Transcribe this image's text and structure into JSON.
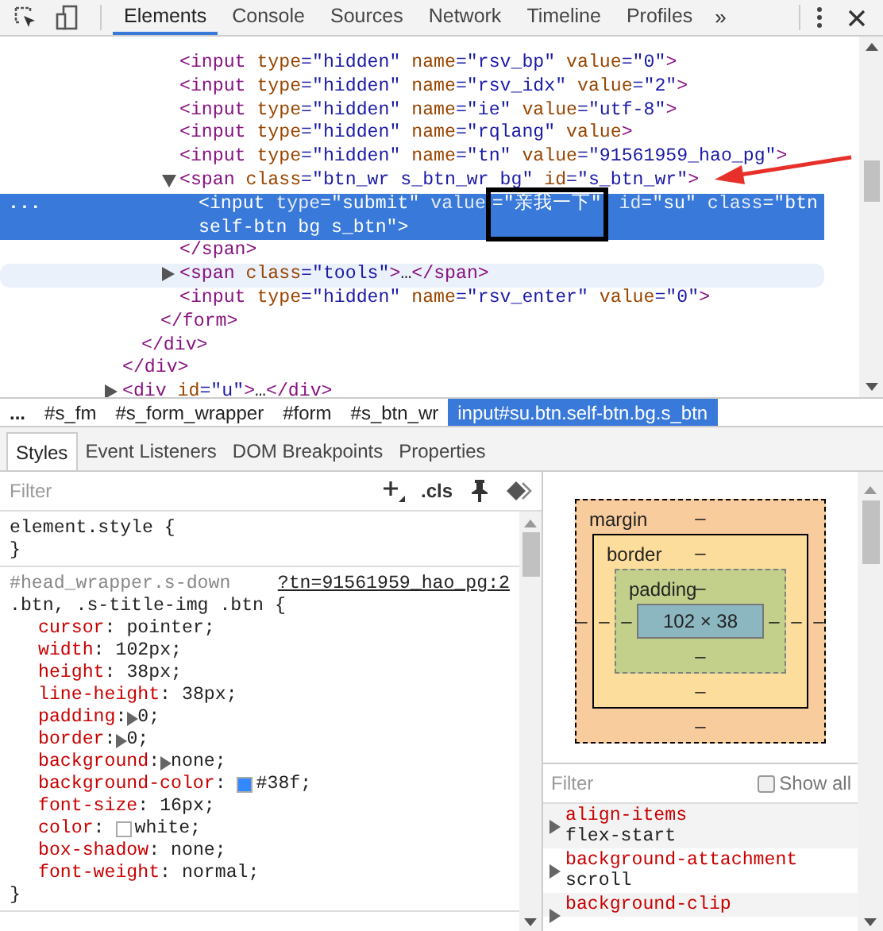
{
  "toolbar": {
    "tabs": [
      {
        "label": "Elements",
        "selected": true
      },
      {
        "label": "Console",
        "selected": false
      },
      {
        "label": "Sources",
        "selected": false
      },
      {
        "label": "Network",
        "selected": false
      },
      {
        "label": "Timeline",
        "selected": false
      },
      {
        "label": "Profiles",
        "selected": false
      }
    ],
    "more": "»"
  },
  "dom_tree": [
    {
      "close": [
        {
          "kind": "tag",
          "text": "</div>"
        }
      ],
      "children": [
        {
          "close": [
            {
              "kind": "tag",
              "text": "</div>"
            }
          ],
          "children": [
            {
              "close": [
                {
                  "kind": "tag",
                  "text": "</form>"
                }
              ],
              "children": [
                {
                  "parts": [
                    {
                      "kind": "tag",
                      "text": "<input"
                    },
                    {
                      "kind": "attr",
                      "text": " type"
                    },
                    {
                      "kind": "value",
                      "text": "=\"hidden\""
                    },
                    {
                      "kind": "attr",
                      "text": " name"
                    },
                    {
                      "kind": "value",
                      "text": "=\"rsv_bp\""
                    },
                    {
                      "kind": "attr",
                      "text": " value"
                    },
                    {
                      "kind": "value",
                      "text": "=\"0\""
                    },
                    {
                      "kind": "tag",
                      "text": ">"
                    }
                  ]
                },
                {
                  "parts": [
                    {
                      "kind": "tag",
                      "text": "<input"
                    },
                    {
                      "kind": "attr",
                      "text": " type"
                    },
                    {
                      "kind": "value",
                      "text": "=\"hidden\""
                    },
                    {
                      "kind": "attr",
                      "text": " name"
                    },
                    {
                      "kind": "value",
                      "text": "=\"rsv_idx\""
                    },
                    {
                      "kind": "attr",
                      "text": " value"
                    },
                    {
                      "kind": "value",
                      "text": "=\"2\""
                    },
                    {
                      "kind": "tag",
                      "text": ">"
                    }
                  ]
                },
                {
                  "parts": [
                    {
                      "kind": "tag",
                      "text": "<input"
                    },
                    {
                      "kind": "attr",
                      "text": " type"
                    },
                    {
                      "kind": "value",
                      "text": "=\"hidden\""
                    },
                    {
                      "kind": "attr",
                      "text": " name"
                    },
                    {
                      "kind": "value",
                      "text": "=\"ie\""
                    },
                    {
                      "kind": "attr",
                      "text": " value"
                    },
                    {
                      "kind": "value",
                      "text": "=\"utf-8\""
                    },
                    {
                      "kind": "tag",
                      "text": ">"
                    }
                  ]
                },
                {
                  "parts": [
                    {
                      "kind": "tag",
                      "text": "<input"
                    },
                    {
                      "kind": "attr",
                      "text": " type"
                    },
                    {
                      "kind": "value",
                      "text": "=\"hidden\""
                    },
                    {
                      "kind": "attr",
                      "text": " name"
                    },
                    {
                      "kind": "value",
                      "text": "=\"rqlang\""
                    },
                    {
                      "kind": "attr",
                      "text": " value"
                    },
                    {
                      "kind": "tag",
                      "text": ">"
                    }
                  ]
                },
                {
                  "parts": [
                    {
                      "kind": "tag",
                      "text": "<input"
                    },
                    {
                      "kind": "attr",
                      "text": " type"
                    },
                    {
                      "kind": "value",
                      "text": "=\"hidden\""
                    },
                    {
                      "kind": "attr",
                      "text": " name"
                    },
                    {
                      "kind": "value",
                      "text": "=\"tn\""
                    },
                    {
                      "kind": "attr",
                      "text": " value"
                    },
                    {
                      "kind": "value",
                      "text": "=\"91561959_hao_pg\""
                    },
                    {
                      "kind": "tag",
                      "text": ">"
                    }
                  ]
                },
                {
                  "parts": [
                    {
                      "kind": "tag",
                      "text": "<span"
                    },
                    {
                      "kind": "attr",
                      "text": " class"
                    },
                    {
                      "kind": "value",
                      "text": "=\"btn_wr s_btn_wr bg\""
                    },
                    {
                      "kind": "attr",
                      "text": " id"
                    },
                    {
                      "kind": "value",
                      "text": "=\"s_btn_wr\""
                    },
                    {
                      "kind": "tag",
                      "text": ">"
                    }
                  ],
                  "expanded": true,
                  "close": [
                    {
                      "kind": "tag",
                      "text": "</span>"
                    }
                  ],
                  "children": [
                    {
                      "parts": [
                        {
                          "kind": "tag",
                          "text": "<input"
                        },
                        {
                          "kind": "attr",
                          "text": " type"
                        },
                        {
                          "kind": "value",
                          "text": "=\"submit\""
                        },
                        {
                          "kind": "attr",
                          "text": " value"
                        },
                        {
                          "kind": "value",
                          "text": "=\"亲我一下\"",
                          "boxed": true
                        },
                        {
                          "kind": "attr",
                          "text": " id"
                        },
                        {
                          "kind": "value",
                          "text": "=\"su\""
                        },
                        {
                          "kind": "attr",
                          "text": " class"
                        },
                        {
                          "kind": "value",
                          "text": "=\"btn self-btn bg s_btn\""
                        },
                        {
                          "kind": "tag",
                          "text": ">"
                        }
                      ],
                      "selected": true,
                      "menu": "..."
                    }
                  ]
                },
                {
                  "parts": [
                    {
                      "kind": "tag",
                      "text": "<span"
                    },
                    {
                      "kind": "attr",
                      "text": " class"
                    },
                    {
                      "kind": "value",
                      "text": "=\"tools\""
                    },
                    {
                      "kind": "tag",
                      "text": ">"
                    },
                    {
                      "kind": "text",
                      "text": "…"
                    },
                    {
                      "kind": "tag",
                      "text": "</span>"
                    }
                  ],
                  "expanded": false,
                  "hovered": true
                },
                {
                  "parts": [
                    {
                      "kind": "tag",
                      "text": "<input"
                    },
                    {
                      "kind": "attr",
                      "text": " type"
                    },
                    {
                      "kind": "value",
                      "text": "=\"hidden\""
                    },
                    {
                      "kind": "attr",
                      "text": " name"
                    },
                    {
                      "kind": "value",
                      "text": "=\"rsv_enter\""
                    },
                    {
                      "kind": "attr",
                      "text": " value"
                    },
                    {
                      "kind": "value",
                      "text": "=\"0\""
                    },
                    {
                      "kind": "tag",
                      "text": ">"
                    }
                  ]
                }
              ]
            }
          ]
        }
      ]
    },
    {
      "parts": [
        {
          "kind": "tag",
          "text": "<div"
        },
        {
          "kind": "attr",
          "text": " id"
        },
        {
          "kind": "value",
          "text": "=\"u\""
        },
        {
          "kind": "tag",
          "text": ">"
        },
        {
          "kind": "text",
          "text": "…"
        },
        {
          "kind": "tag",
          "text": "</div>"
        }
      ],
      "expanded": false
    }
  ],
  "breadcrumbs": [
    {
      "label": "...",
      "selected": false
    },
    {
      "label": "#s_fm",
      "selected": false
    },
    {
      "label": "#s_form_wrapper",
      "selected": false
    },
    {
      "label": "#form",
      "selected": false
    },
    {
      "label": "#s_btn_wr",
      "selected": false
    },
    {
      "label": "input#su.btn.self-btn.bg.s_btn",
      "selected": true
    }
  ],
  "sidebar_tabs": [
    {
      "label": "Styles",
      "selected": true
    },
    {
      "label": "Event Listeners",
      "selected": false
    },
    {
      "label": "DOM Breakpoints",
      "selected": false
    },
    {
      "label": "Properties",
      "selected": false
    }
  ],
  "styles": {
    "filter": {
      "placeholder": "Filter"
    },
    "cls": ".cls",
    "rules": [
      {
        "selector": [
          {
            "text": "element.style {",
            "matched": true
          }
        ],
        "close": "}"
      },
      {
        "selector": [
          {
            "text": "#head_wrapper.s-down",
            "matched": false
          },
          {
            "text": ".btn, .s-title-img .btn {",
            "matched": true
          }
        ],
        "source": "?tn=91561959_hao_pg:2",
        "close": "}",
        "properties": [
          {
            "name": "cursor",
            "colon": ":",
            "value": "pointer;",
            "expandable": false
          },
          {
            "name": "width",
            "colon": ":",
            "value": "102px;",
            "expandable": false
          },
          {
            "name": "height",
            "colon": ":",
            "value": "38px;",
            "expandable": false
          },
          {
            "name": "line-height",
            "colon": ":",
            "value": "38px;",
            "expandable": false
          },
          {
            "name": "padding",
            "colon": ":",
            "value": "0;",
            "expandable": true
          },
          {
            "name": "border",
            "colon": ":",
            "value": "0;",
            "expandable": true
          },
          {
            "name": "background",
            "colon": ":",
            "value": "none;",
            "expandable": true
          },
          {
            "name": "background-color",
            "colon": ":",
            "value": "#38f;",
            "expandable": false,
            "color": "#3388ff"
          },
          {
            "name": "font-size",
            "colon": ":",
            "value": "16px;",
            "expandable": false
          },
          {
            "name": "color",
            "colon": ":",
            "value": "white;",
            "expandable": false,
            "color": "#ffffff"
          },
          {
            "name": "box-shadow",
            "colon": ":",
            "value": "none;",
            "expandable": false
          },
          {
            "name": "font-weight",
            "colon": ":",
            "value": "normal;",
            "expandable": false
          }
        ]
      }
    ]
  },
  "box_model": {
    "margin": {
      "label": "margin",
      "top": "–",
      "right": "–",
      "bottom": "–",
      "left": "–"
    },
    "border": {
      "label": "border",
      "top": "–",
      "right": "–",
      "bottom": "–",
      "left": "–"
    },
    "padding": {
      "label": "padding",
      "top": "–",
      "right": "–",
      "bottom": "–",
      "left": "–"
    },
    "content": "102 × 38"
  },
  "computed": {
    "filter": {
      "placeholder": "Filter"
    },
    "show_all": {
      "label": "Show all",
      "checked": false
    },
    "rows": [
      {
        "name": "align-items",
        "value": "flex-start"
      },
      {
        "name": "background-attachment",
        "value": "scroll"
      },
      {
        "name": "background-clip"
      }
    ]
  }
}
